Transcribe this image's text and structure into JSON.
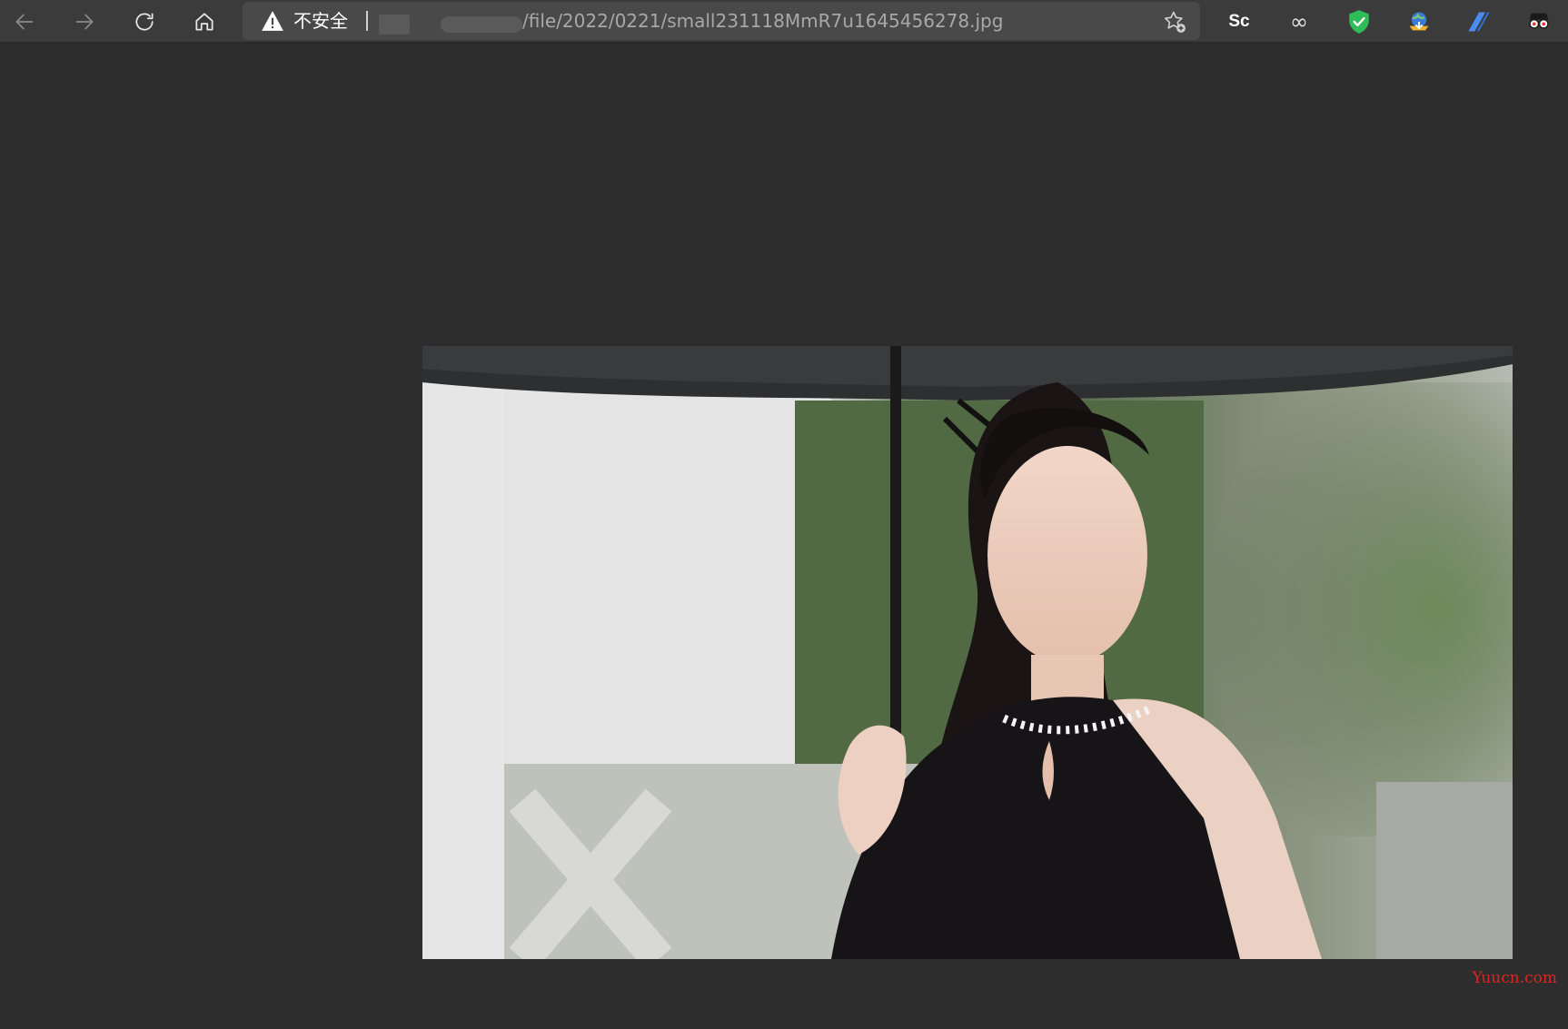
{
  "browser": {
    "security_label": "不安全",
    "url_path": "/file/2022/0221/small231118MmR7u1645456278.jpg"
  },
  "extensions": {
    "sc_label": "Sc",
    "infinity_label": "∞"
  },
  "watermark": "Yuucn.com"
}
